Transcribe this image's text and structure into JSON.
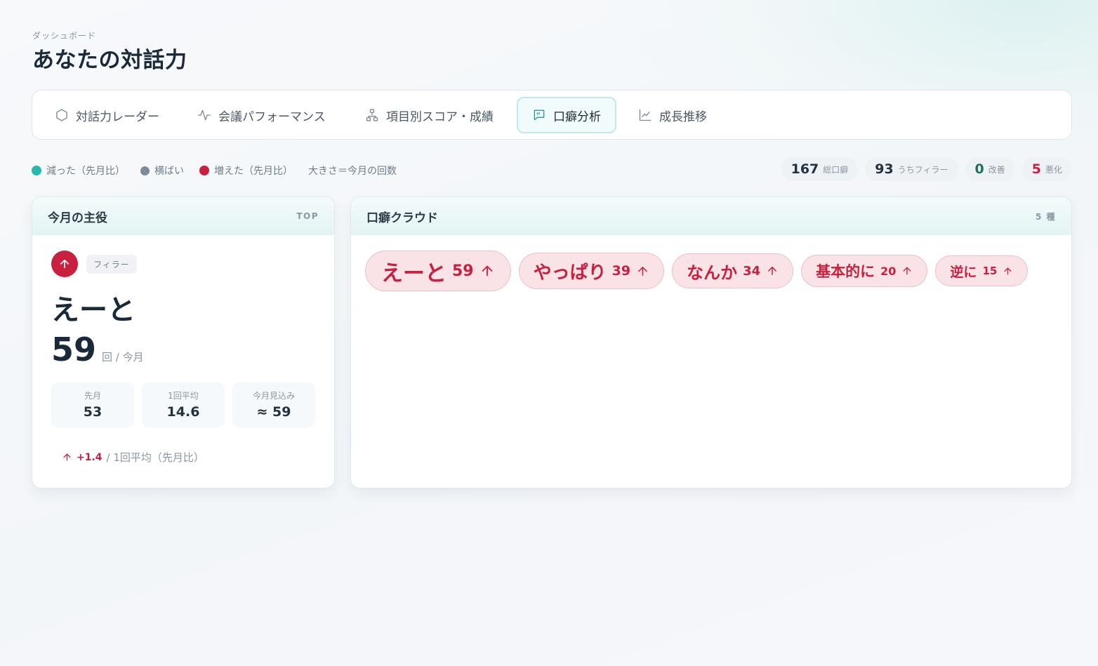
{
  "header": {
    "breadcrumb": "ダッシュボード",
    "title": "あなたの対話力"
  },
  "tabs": [
    {
      "label": "対話力レーダー",
      "icon": "hexagon-icon"
    },
    {
      "label": "会議パフォーマンス",
      "icon": "pulse-icon"
    },
    {
      "label": "項目別スコア・成績",
      "icon": "hierarchy-icon"
    },
    {
      "label": "口癖分析",
      "icon": "message-quote-icon",
      "active": true
    },
    {
      "label": "成長推移",
      "icon": "line-chart-icon"
    }
  ],
  "legend": {
    "decreased": "減った（先月比）",
    "flat": "横ばい",
    "increased": "増えた（先月比）",
    "size_note": "大きさ＝今月の回数",
    "colors": {
      "decreased": "#25b8ad",
      "flat": "#6f7d8c",
      "increased": "#c8203f"
    }
  },
  "stats": [
    {
      "value": "167",
      "label": "総口癖"
    },
    {
      "value": "93",
      "label": "うちフィラー"
    },
    {
      "value": "0",
      "label": "改善"
    },
    {
      "value": "5",
      "label": "悪化"
    }
  ],
  "hero": {
    "title": "今月の主役",
    "tag": "TOP",
    "category": "フィラー",
    "word": "えーと",
    "count": "59",
    "count_unit": "回 / 今月",
    "metrics": [
      {
        "label": "先月",
        "value": "53"
      },
      {
        "label": "1回平均",
        "value": "14.6"
      },
      {
        "label": "今月見込み",
        "value": "≈ 59"
      }
    ],
    "delta_value": "+1.4",
    "delta_text": "/ 1回平均（先月比）"
  },
  "cloud": {
    "title": "口癖クラウド",
    "count_label": "5 種",
    "items": [
      {
        "word": "えーと",
        "count": "59",
        "trend": "up"
      },
      {
        "word": "やっぱり",
        "count": "39",
        "trend": "up"
      },
      {
        "word": "なんか",
        "count": "34",
        "trend": "up"
      },
      {
        "word": "基本的に",
        "count": "20",
        "trend": "up"
      },
      {
        "word": "逆に",
        "count": "15",
        "trend": "up"
      }
    ]
  }
}
